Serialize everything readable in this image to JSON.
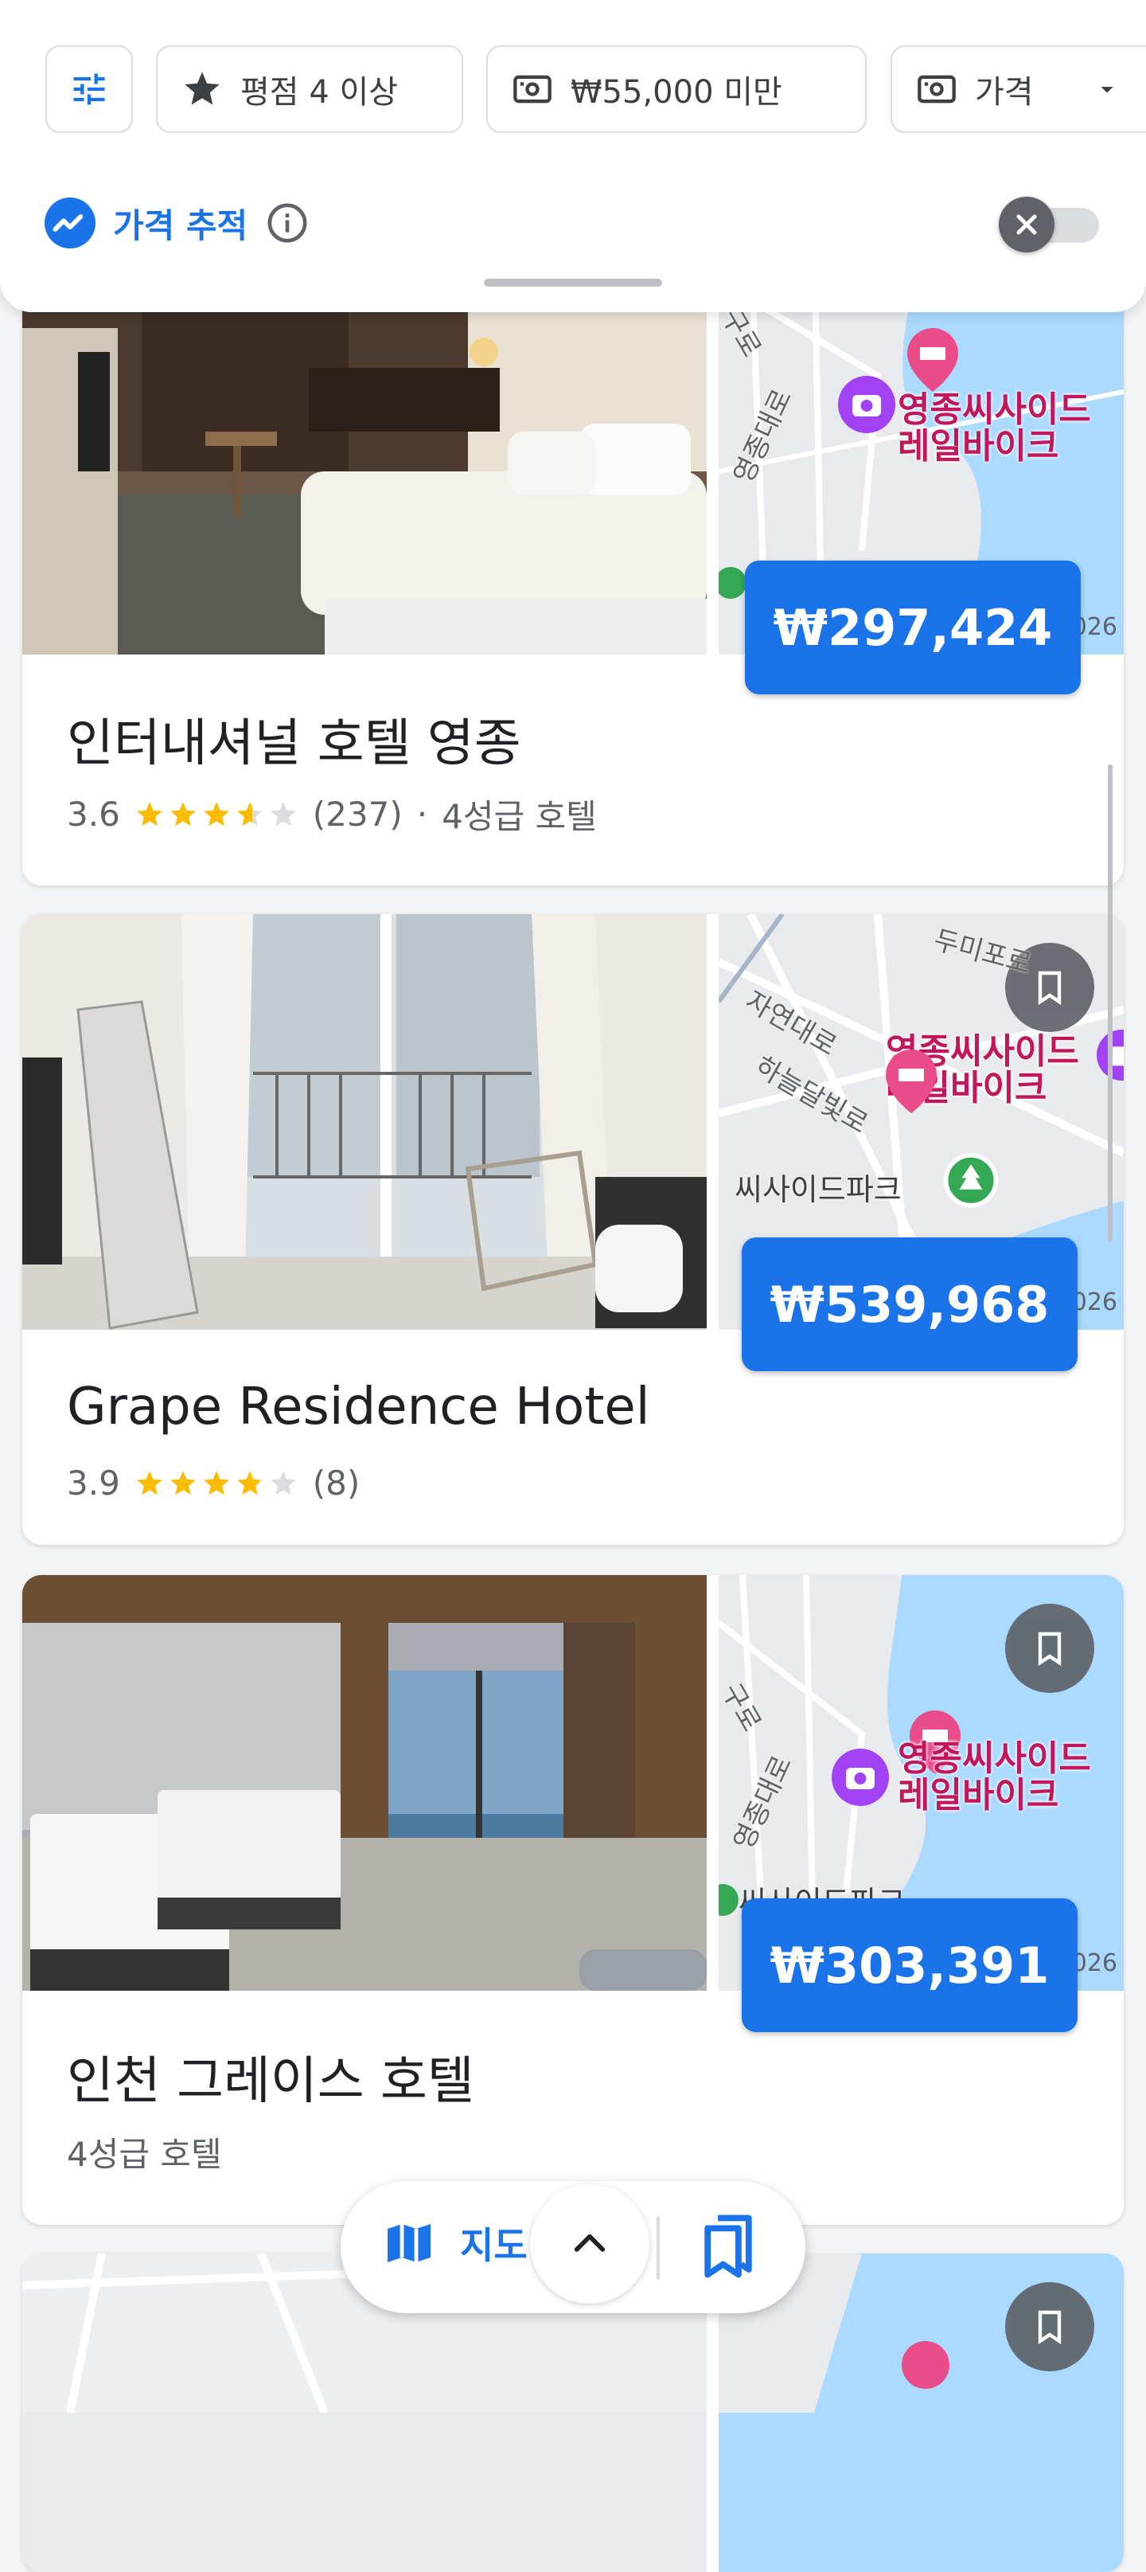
{
  "filters": {
    "rating_label": "평점 4 이상",
    "under_label": "₩55,000 미만",
    "price_label": "가격"
  },
  "price_tracking": {
    "label": "가격 추적",
    "enabled": false
  },
  "hotels": [
    {
      "name": "인터내셔널 호텔 영종",
      "rating": "3.6",
      "rating_value": 3.6,
      "reviews": "(237)",
      "separator": "·",
      "class": "4성급 호텔",
      "price": "₩297,424",
      "map_poi": [
        "영종씨사이드",
        "레일바이크"
      ],
      "map_roads": [
        "구로",
        "영종대로"
      ],
      "map_year": "026"
    },
    {
      "name": "Grape Residence Hotel",
      "rating": "3.9",
      "rating_value": 3.9,
      "reviews": "(8)",
      "price": "₩539,968",
      "map_poi": [
        "영종씨사이드",
        "레일바이크"
      ],
      "map_roads": [
        "두미포로",
        "자연대로",
        "하늘달빛로",
        "씨사이드파크"
      ],
      "map_year": "026"
    },
    {
      "name": "인천 그레이스 호텔",
      "class": "4성급 호텔",
      "price": "₩303,391",
      "map_poi": [
        "영종씨사이드",
        "레일바이크"
      ],
      "map_roads": [
        "구로",
        "영종대로",
        "씨사이드파크"
      ],
      "map_year": "026"
    }
  ],
  "bottom_bar": {
    "map_label": "지도"
  }
}
